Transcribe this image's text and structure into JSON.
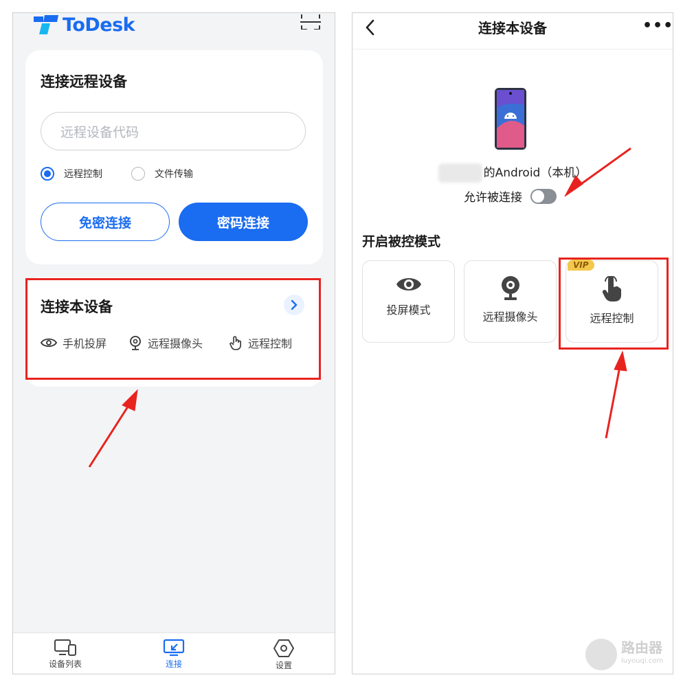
{
  "left": {
    "brand": "ToDesk",
    "connect_remote": {
      "title": "连接远程设备",
      "input_placeholder": "远程设备代码",
      "radio_options": [
        {
          "label": "远程控制",
          "selected": true
        },
        {
          "label": "文件传输",
          "selected": false
        }
      ],
      "btn_no_password": "免密连接",
      "btn_password": "密码连接"
    },
    "connect_this": {
      "title": "连接本设备",
      "features": [
        "手机投屏",
        "远程摄像头",
        "远程控制"
      ]
    },
    "tabs": [
      {
        "label": "设备列表",
        "icon": "devices-icon",
        "active": false
      },
      {
        "label": "连接",
        "icon": "connect-icon",
        "active": true
      },
      {
        "label": "设置",
        "icon": "settings-icon",
        "active": false
      }
    ]
  },
  "right": {
    "nav_title": "连接本设备",
    "more": "•••",
    "device_name": "的Android（本机）",
    "allow_label": "允许被连接",
    "allow_enabled": false,
    "section_title": "开启被控模式",
    "modes": [
      {
        "label": "投屏模式",
        "icon": "eye-icon",
        "vip": false
      },
      {
        "label": "远程摄像头",
        "icon": "webcam-icon",
        "vip": false
      },
      {
        "label": "远程控制",
        "icon": "touch-hand-icon",
        "vip": true
      }
    ],
    "vip_badge": "VIP"
  },
  "watermark": {
    "main": "路由器",
    "sub": "luyouqi.com"
  },
  "colors": {
    "accent": "#1a6cf0",
    "annotation": "#e8231f",
    "vip": "#f3c84b"
  }
}
